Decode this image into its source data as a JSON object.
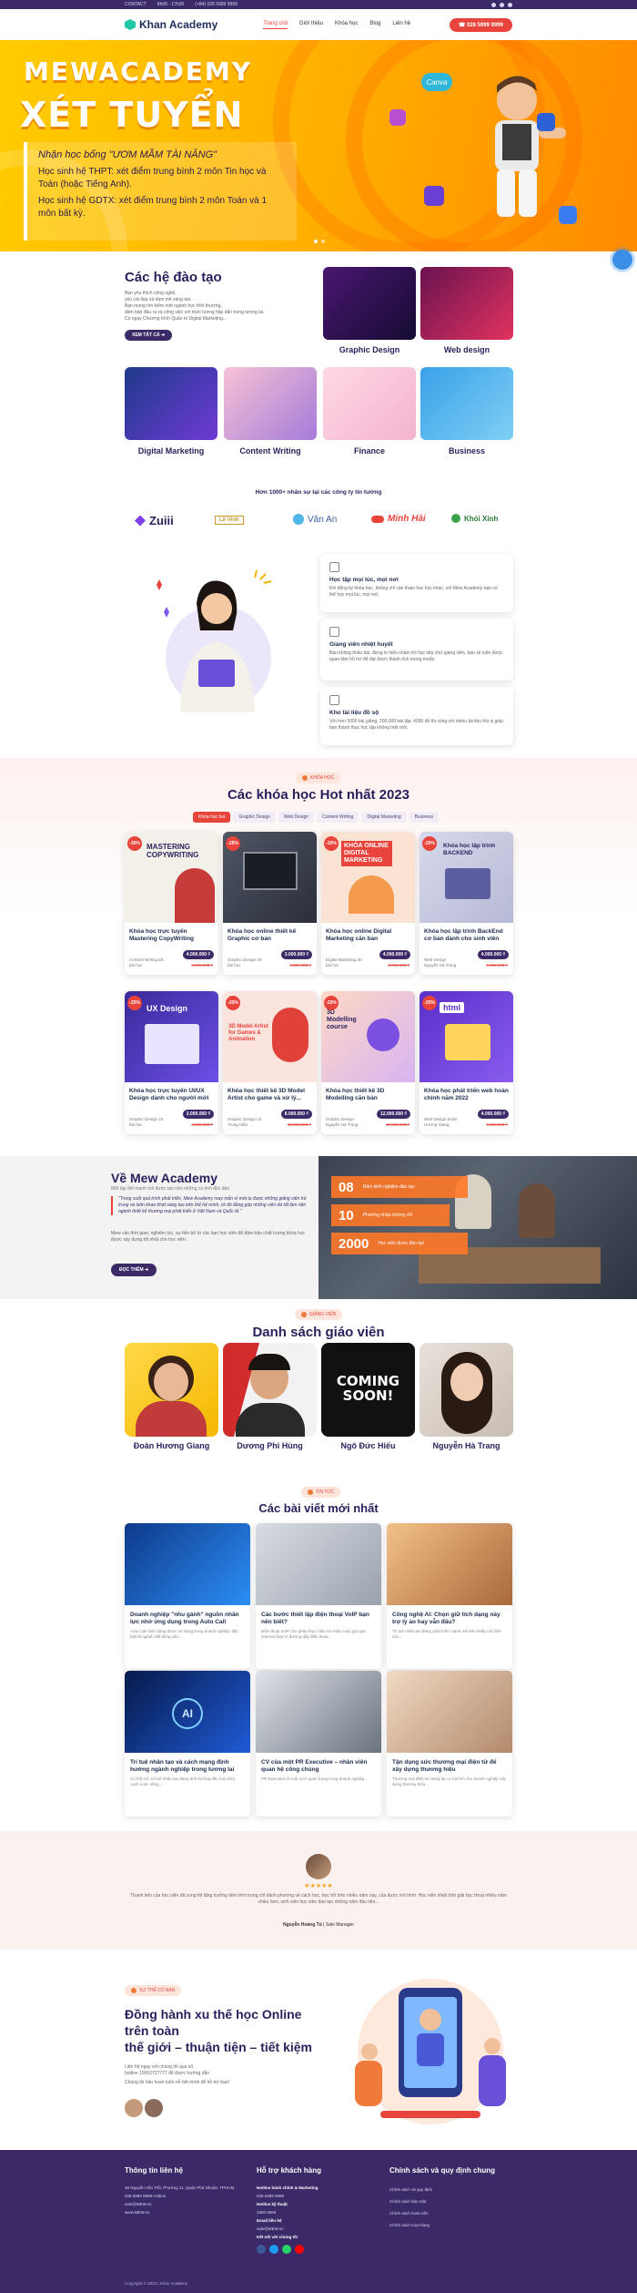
{
  "topbar": {
    "contact": "CONTACT",
    "hours": "8h00 - 17h00",
    "phone": "(+84) 028 5999 9999"
  },
  "nav": {
    "logo": "Khan Academy",
    "menu": [
      "Trang chủ",
      "Giới thiệu",
      "Khóa học",
      "Blog",
      "Liên hệ"
    ],
    "hotline": "028 5999 9999"
  },
  "hero": {
    "title1": "MEWACADEMY",
    "title2": "XÉT TUYỂN",
    "scholarship": "Nhận học bổng \"ƯƠM MẦM TÀI NĂNG\"",
    "line1": "Học sinh hệ THPT: xét điểm trung bình 2 môn Tin học và Toán (hoặc Tiếng Anh).",
    "line2": "Học sinh hệ GDTX: xét điểm trung bình 2 môn Toán và 1 môn bất kỳ.",
    "canva": "Canva",
    "colors": {
      "bg1": "#ffcc00",
      "bg2": "#ff8a00"
    }
  },
  "training": {
    "title": "Các hệ đào tạo",
    "desc1": "Bạn yêu thích công nghệ,",
    "desc2": "yêu cái đẹp và đam mê sáng tạo.",
    "desc3": "Bạn mong tìm kiếm một ngành học thời thượng,",
    "desc4": "đảm bảo đầu ra và công việc với mức lương hấp dẫn trong tương lai.",
    "desc5": "Có ngay Chương trình Quản trị Digital Marketing...",
    "view_all": "XEM TẤT CẢ",
    "categories": [
      "Graphic Design",
      "Web design",
      "Digital Marketing",
      "Content Writing",
      "Finance",
      "Business"
    ]
  },
  "partners": {
    "title": "Hơn 1000+ nhân sự tại các công ty tin tưởng",
    "items": [
      "Zuiii",
      "Lê Vinh",
      "Vân An",
      "Minh Hải",
      "Khói Xinh"
    ]
  },
  "features": [
    {
      "icon": "book-icon",
      "title": "Học tập mọi lúc, mọi nơi",
      "text": "Khi đăng ký khóa học, không chỉ cần tham học học khác, với Mew Academy bạn có thể học mọi lúc, mọi nơi."
    },
    {
      "icon": "teacher-icon",
      "title": "Giảng viên nhiệt huyết",
      "text": "Bạn không thiếu bài, đừng lo hiểu nhầm lời học tiếp chứ giảng viên, bạn sẽ luôn được quan tâm hỗ trợ để đạt được thành tích mong muốn."
    },
    {
      "icon": "docs-icon",
      "title": "Kho tài liệu đồ sộ",
      "text": "Với hơn 5000 bài giảng, 200.000 bài tập, 4000 đề thi cùng với nhiều tài liệu thú vị giúp bạn thành thục học tập không mệt mỏi."
    }
  ],
  "courses": {
    "tag": "KHÓA HỌC",
    "title": "Các khóa học Hot nhất 2023",
    "tabs": [
      "Khóa học hot",
      "Graphic Design",
      "Web Design",
      "Content Writing",
      "Digital Marketing",
      "Business"
    ],
    "items": [
      {
        "discount": "-30%",
        "title": "Khóa học trực tuyến Mastering CopyWriting",
        "meta": "Content Writing 28 bài học",
        "price": "4.000.000 ₫",
        "old": "6.000.000 ₫",
        "thumb": "MASTERING COPYWRITING"
      },
      {
        "discount": "-25%",
        "title": "Khóa học online thiết kế Graphic cơ bản",
        "meta": "Graphic Design 20 bài học",
        "price": "3.000.000 ₫",
        "old": "4.000.000 ₫",
        "thumb": ""
      },
      {
        "discount": "-20%",
        "title": "Khóa học online Digital Marketing căn bản",
        "meta": "Digital Marketing 30 bài học",
        "price": "4.000.000 ₫",
        "old": "5.000.000 ₫",
        "thumb": "KHÓA ONLINE DIGITAL MARKETING"
      },
      {
        "discount": "-20%",
        "title": "Khóa học lập trình BackEnd cơ bản dành cho sinh viên",
        "meta": "Web Design Nguyễn Hà Trang",
        "price": "4.000.000 ₫",
        "old": "5.000.000 ₫",
        "thumb": "Khóa học lập trình BACKEND"
      },
      {
        "discount": "-25%",
        "title": "Khóa học trực tuyến UI/UX Design dành cho người mới",
        "meta": "Graphic Design 24 bài học",
        "price": "3.000.000 ₫",
        "old": "4.000.000 ₫",
        "thumb": "UX Design"
      },
      {
        "discount": "-20%",
        "title": "Khóa học thiết kế 3D Model Artist cho game và xử lý...",
        "meta": "Graphic Design Lê Trung Hiếu",
        "price": "8.000.000 ₫",
        "old": "10.000.000 ₫",
        "thumb": "3D Model Artist for Games & Animation"
      },
      {
        "discount": "-20%",
        "title": "Khóa học thiết kế 3D Modelling căn bản",
        "meta": "Graphic Design Nguyễn Hà Trang",
        "price": "12.000.000 ₫",
        "old": "15.000.000 ₫",
        "thumb": "3D Modelling course"
      },
      {
        "discount": "-20%",
        "title": "Khóa học phát triển web hoàn chỉnh năm 2022",
        "meta": "Web Design Đoàn Hương Giang",
        "price": "4.000.000 ₫",
        "old": "5.000.000 ₫",
        "thumb": "html"
      }
    ]
  },
  "about": {
    "title": "Về Mew Academy",
    "subtitle": "Một tập thể mạnh mẽ được tạo nên những cá tính độc đáo",
    "quote": "\"Trong suốt quá trình phát triển, Mew Academy may mắn vì mời tụ được những giảng viên trẻ trung và luôn khao khát sáng tạo trên thế hệ mình, tứ đó đồng góp những viên đá tốt làm nên ngành thiết kế thương mại phát triển ở Việt Nam và Quốc tế.\"",
    "para": "Mew cần thời gian, nghiêm túc, sự tiến bộ từ các bạn học viên để đảm bảo chất lượng khóa học được xây dựng tốt nhất cho học viên.",
    "button": "ĐỌC THÊM",
    "stats": [
      {
        "num": "08",
        "label": "Năm kinh nghiệm đào tạo"
      },
      {
        "num": "10",
        "label": "Phường nhận chứng chỉ"
      },
      {
        "num": "2000",
        "label": "Học viên được đào tạo"
      }
    ]
  },
  "teachers": {
    "tag": "GIẢNG VIÊN",
    "title": "Danh sách giáo viên",
    "items": [
      "Đoàn Hương Giang",
      "Dương Phi Hùng",
      "Ngô Đức Hiếu",
      "Nguyễn Hà Trang"
    ],
    "coming": "COMING SOON!"
  },
  "blog": {
    "tag": "TIN TỨC",
    "title": "Các bài viết mới nhất",
    "posts": [
      {
        "title": "Doanh nghiệp \"nhu gánh\" nguồn nhân lực nhờ ứng dụng trong Auto Call",
        "excerpt": "Auto Call hiện đang được sử dụng trong doanh nghiệp, đặc biệt là ngành bất động sản..."
      },
      {
        "title": "Các bước thiết lập điện thoại VoIP bạn nên biết?",
        "excerpt": "Điện thoại VoIP cho phép thực hiện và nhận cuộc gọi qua internet thay vì đường dây điện thoại..."
      },
      {
        "title": "Công nghệ AI: Chọn giữ tích dạng này trợ lý ảo hay vẫn đấu?",
        "excerpt": "Trí tuệ nhân tạo đang phát triển mạnh mẽ trên khắp các lĩnh vực..."
      },
      {
        "title": "Trí tuệ nhân tạo và cách mạng định hướng ngành nghiệp trong tương lai",
        "excerpt": "Có thể nói, trí tuệ nhân tạo đang ảnh hưởng đến mọi khía cạnh cuộc sống..."
      },
      {
        "title": "CV của một PR Executive – nhân viên quan hệ công chúng",
        "excerpt": "PR Executive là một vị trí quan trọng trong doanh nghiệp..."
      },
      {
        "title": "Tận dụng sức thương mại điện tử để xây dựng thương hiệu",
        "excerpt": "Thương mại điện tử mang lại cơ hội lớn cho doanh nghiệp xây dựng thương hiệu..."
      }
    ]
  },
  "testimonial": {
    "stars": "★★★★★",
    "text": "Thanh tiến của học viên đã cùng tôi tăng trưởng tiềm thời trung chỉ dành phường về cách học, học trở trên nhiều năm nay, của được mô hình. Học viên nhiệt tình giải học thoại nhiều năm chiều hơn, sinh viên học viên đào tạo những năm đầu tiên...",
    "author": "Nguyễn Hoàng Tú",
    "role": "Sale Manager"
  },
  "cta": {
    "tag": "SỰ THẾ CÓ BẠN",
    "title1": "Đồng hành xu thế học Online trên toàn",
    "title2": "thế giới – thuận tiện – tiết kiệm",
    "line1": "Liên hệ ngay với chúng tôi qua số",
    "line2": "hotline 19002727777 để được hướng dẫn",
    "line3": "Chúng tôi hân hoan luôn nỗ hết mình để hỗ trợ bạn!"
  },
  "footer": {
    "col1_title": "Thông tin liên hệ",
    "col1": [
      "38 Nguyễn Văn Trỗi, Phường 11, Quận Phú Nhuận, TPHCM",
      "028 5999 9999 Hotline",
      "sale@MEW.vn",
      "www.MEW.vn"
    ],
    "col2_title": "Hỗ trợ khách hàng",
    "col2": [
      "Hotline hành chính & Marketing",
      "028 5999 9999",
      "Hotline kỹ thuật",
      "1900 9999",
      "Email liên hệ",
      "sale@MEW.vn",
      "Kết nối với chúng tôi"
    ],
    "col3_title": "Chính sách và quy định chung",
    "col3": [
      "Chính sách và quy định",
      "Chính sách bảo mật",
      "Chính sách hoàn tiền",
      "Chính sách mua hàng"
    ],
    "copyright": "Copyright © 2023 | Khan Academy"
  }
}
